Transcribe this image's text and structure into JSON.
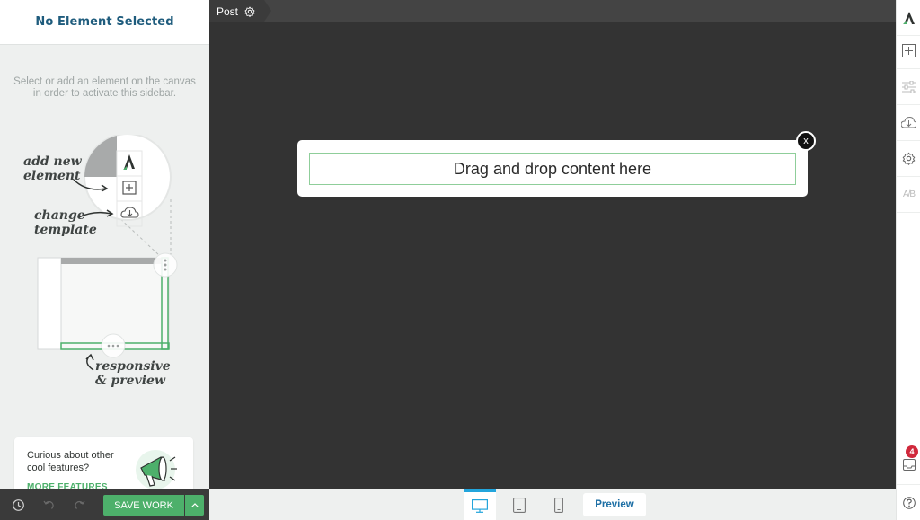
{
  "sidebar": {
    "title": "No Element Selected",
    "help_text": "Select or add an element on the canvas in order to activate this sidebar.",
    "illustration": {
      "label_add": "add new element",
      "label_template": "change template",
      "label_responsive": "responsive & preview"
    },
    "promo": {
      "text": "Curious about other cool features?",
      "link": "MORE FEATURES"
    }
  },
  "topbar": {
    "tab_label": "Post"
  },
  "canvas": {
    "dropzone_text": "Drag and drop content here",
    "close_label": "x"
  },
  "rail": {
    "ab_label": "A/B",
    "notification_count": "4"
  },
  "bottom": {
    "save_label": "SAVE WORK",
    "preview_label": "Preview"
  },
  "colors": {
    "accent_green": "#4db06b",
    "accent_blue": "#23a5dc",
    "title_blue": "#1f5c7d",
    "badge_red": "#d0283b"
  }
}
